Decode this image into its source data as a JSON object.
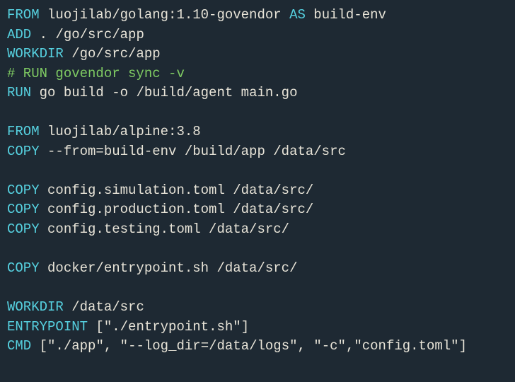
{
  "lines": [
    {
      "type": "code",
      "parts": [
        {
          "cls": "kw",
          "t": "FROM"
        },
        {
          "cls": "path",
          "t": " luojilab/golang:1.10-govendor "
        },
        {
          "cls": "kw",
          "t": "AS"
        },
        {
          "cls": "path",
          "t": " build-env"
        }
      ]
    },
    {
      "type": "code",
      "parts": [
        {
          "cls": "kw",
          "t": "ADD"
        },
        {
          "cls": "path",
          "t": " . /go/src/app"
        }
      ]
    },
    {
      "type": "code",
      "parts": [
        {
          "cls": "kw",
          "t": "WORKDIR"
        },
        {
          "cls": "path",
          "t": " /go/src/app"
        }
      ]
    },
    {
      "type": "comment",
      "t": "# RUN govendor sync -v"
    },
    {
      "type": "code",
      "parts": [
        {
          "cls": "kw",
          "t": "RUN"
        },
        {
          "cls": "path",
          "t": " go build -o /build/agent main.go"
        }
      ]
    },
    {
      "type": "blank"
    },
    {
      "type": "code",
      "parts": [
        {
          "cls": "kw",
          "t": "FROM"
        },
        {
          "cls": "path",
          "t": " luojilab/alpine:3.8"
        }
      ]
    },
    {
      "type": "code",
      "parts": [
        {
          "cls": "kw",
          "t": "COPY"
        },
        {
          "cls": "path",
          "t": " --from=build-env /build/app /data/src"
        }
      ]
    },
    {
      "type": "blank"
    },
    {
      "type": "code",
      "parts": [
        {
          "cls": "kw",
          "t": "COPY"
        },
        {
          "cls": "path",
          "t": " config.simulation.toml /data/src/"
        }
      ]
    },
    {
      "type": "code",
      "parts": [
        {
          "cls": "kw",
          "t": "COPY"
        },
        {
          "cls": "path",
          "t": " config.production.toml /data/src/"
        }
      ]
    },
    {
      "type": "code",
      "parts": [
        {
          "cls": "kw",
          "t": "COPY"
        },
        {
          "cls": "path",
          "t": " config.testing.toml /data/src/"
        }
      ]
    },
    {
      "type": "blank"
    },
    {
      "type": "code",
      "parts": [
        {
          "cls": "kw",
          "t": "COPY"
        },
        {
          "cls": "path",
          "t": " docker/entrypoint.sh /data/src/"
        }
      ]
    },
    {
      "type": "blank"
    },
    {
      "type": "code",
      "parts": [
        {
          "cls": "kw",
          "t": "WORKDIR"
        },
        {
          "cls": "path",
          "t": " /data/src"
        }
      ]
    },
    {
      "type": "code",
      "parts": [
        {
          "cls": "kw",
          "t": "ENTRYPOINT"
        },
        {
          "cls": "punct",
          "t": " ["
        },
        {
          "cls": "str",
          "t": "\"./entrypoint.sh\""
        },
        {
          "cls": "punct",
          "t": "]"
        }
      ]
    },
    {
      "type": "code",
      "parts": [
        {
          "cls": "kw",
          "t": "CMD"
        },
        {
          "cls": "punct",
          "t": " ["
        },
        {
          "cls": "str",
          "t": "\"./app\""
        },
        {
          "cls": "punct",
          "t": ", "
        },
        {
          "cls": "str",
          "t": "\"--log_dir=/data/logs\""
        },
        {
          "cls": "punct",
          "t": ", "
        },
        {
          "cls": "str",
          "t": "\"-c\""
        },
        {
          "cls": "punct",
          "t": ","
        },
        {
          "cls": "str",
          "t": "\"config.toml\""
        },
        {
          "cls": "punct",
          "t": "]"
        }
      ]
    }
  ]
}
